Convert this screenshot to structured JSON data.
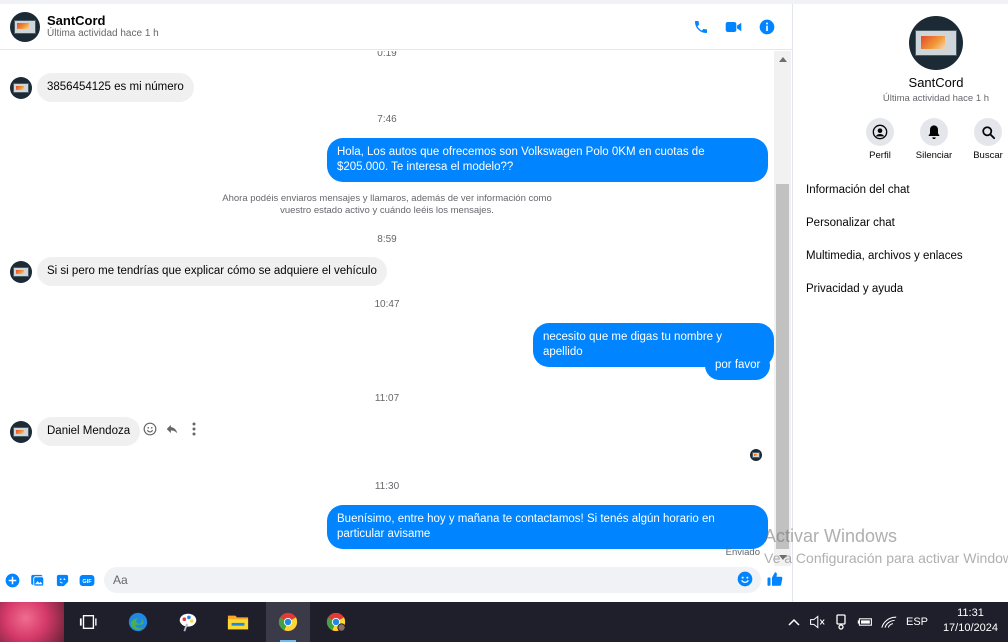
{
  "header": {
    "name": "SantCord",
    "status": "Última actividad hace 1 h",
    "icons": [
      "phone-icon",
      "video-call-icon",
      "info-icon"
    ]
  },
  "messages": {
    "timestamps": [
      "0:19",
      "7:46",
      "8:59",
      "10:47",
      "11:07",
      "11:30"
    ],
    "msg1": "3856454125 es mi número",
    "msg2": "Hola, Los autos que ofrecemos son Volkswagen Polo 0KM en cuotas de $205.000. Te interesa el modelo??",
    "system_notice": "Ahora podéis enviaros mensajes y llamaros, además de ver información como vuestro estado activo y cuándo leéis los mensajes.",
    "msg3": "Si si pero me tendrías que explicar cómo se adquiere el vehículo",
    "msg4": "necesito que me digas tu nombre y apellido",
    "msg5": "por favor",
    "msg6": "Daniel Mendoza",
    "msg7": "Buenísimo, entre hoy y mañana te contactamos! Si tenés algún horario en particular avisame",
    "sent_status": "Enviado"
  },
  "composer": {
    "placeholder": "Aa",
    "icons": [
      "plus-icon",
      "image-icon",
      "sticker-icon",
      "gif-icon",
      "emoji-icon",
      "like-icon"
    ]
  },
  "sidebar": {
    "name": "SantCord",
    "status": "Última actividad hace 1 h",
    "actions": [
      {
        "label": "Perfil",
        "icon": "profile-icon"
      },
      {
        "label": "Silenciar",
        "icon": "bell-icon"
      },
      {
        "label": "Buscar",
        "icon": "search-icon"
      }
    ],
    "items": [
      "Información del chat",
      "Personalizar chat",
      "Multimedia, archivos y enlaces",
      "Privacidad y ayuda"
    ]
  },
  "watermark": {
    "line1": "Activar Windows",
    "line2": "Ve a Configuración para activar Windows."
  },
  "taskbar": {
    "language": "ESP",
    "time": "11:31",
    "date": "17/10/2024"
  },
  "colors": {
    "accent": "#0084ff",
    "incoming_bubble": "#f0f0f0",
    "taskbar": "#1f1f2b"
  }
}
